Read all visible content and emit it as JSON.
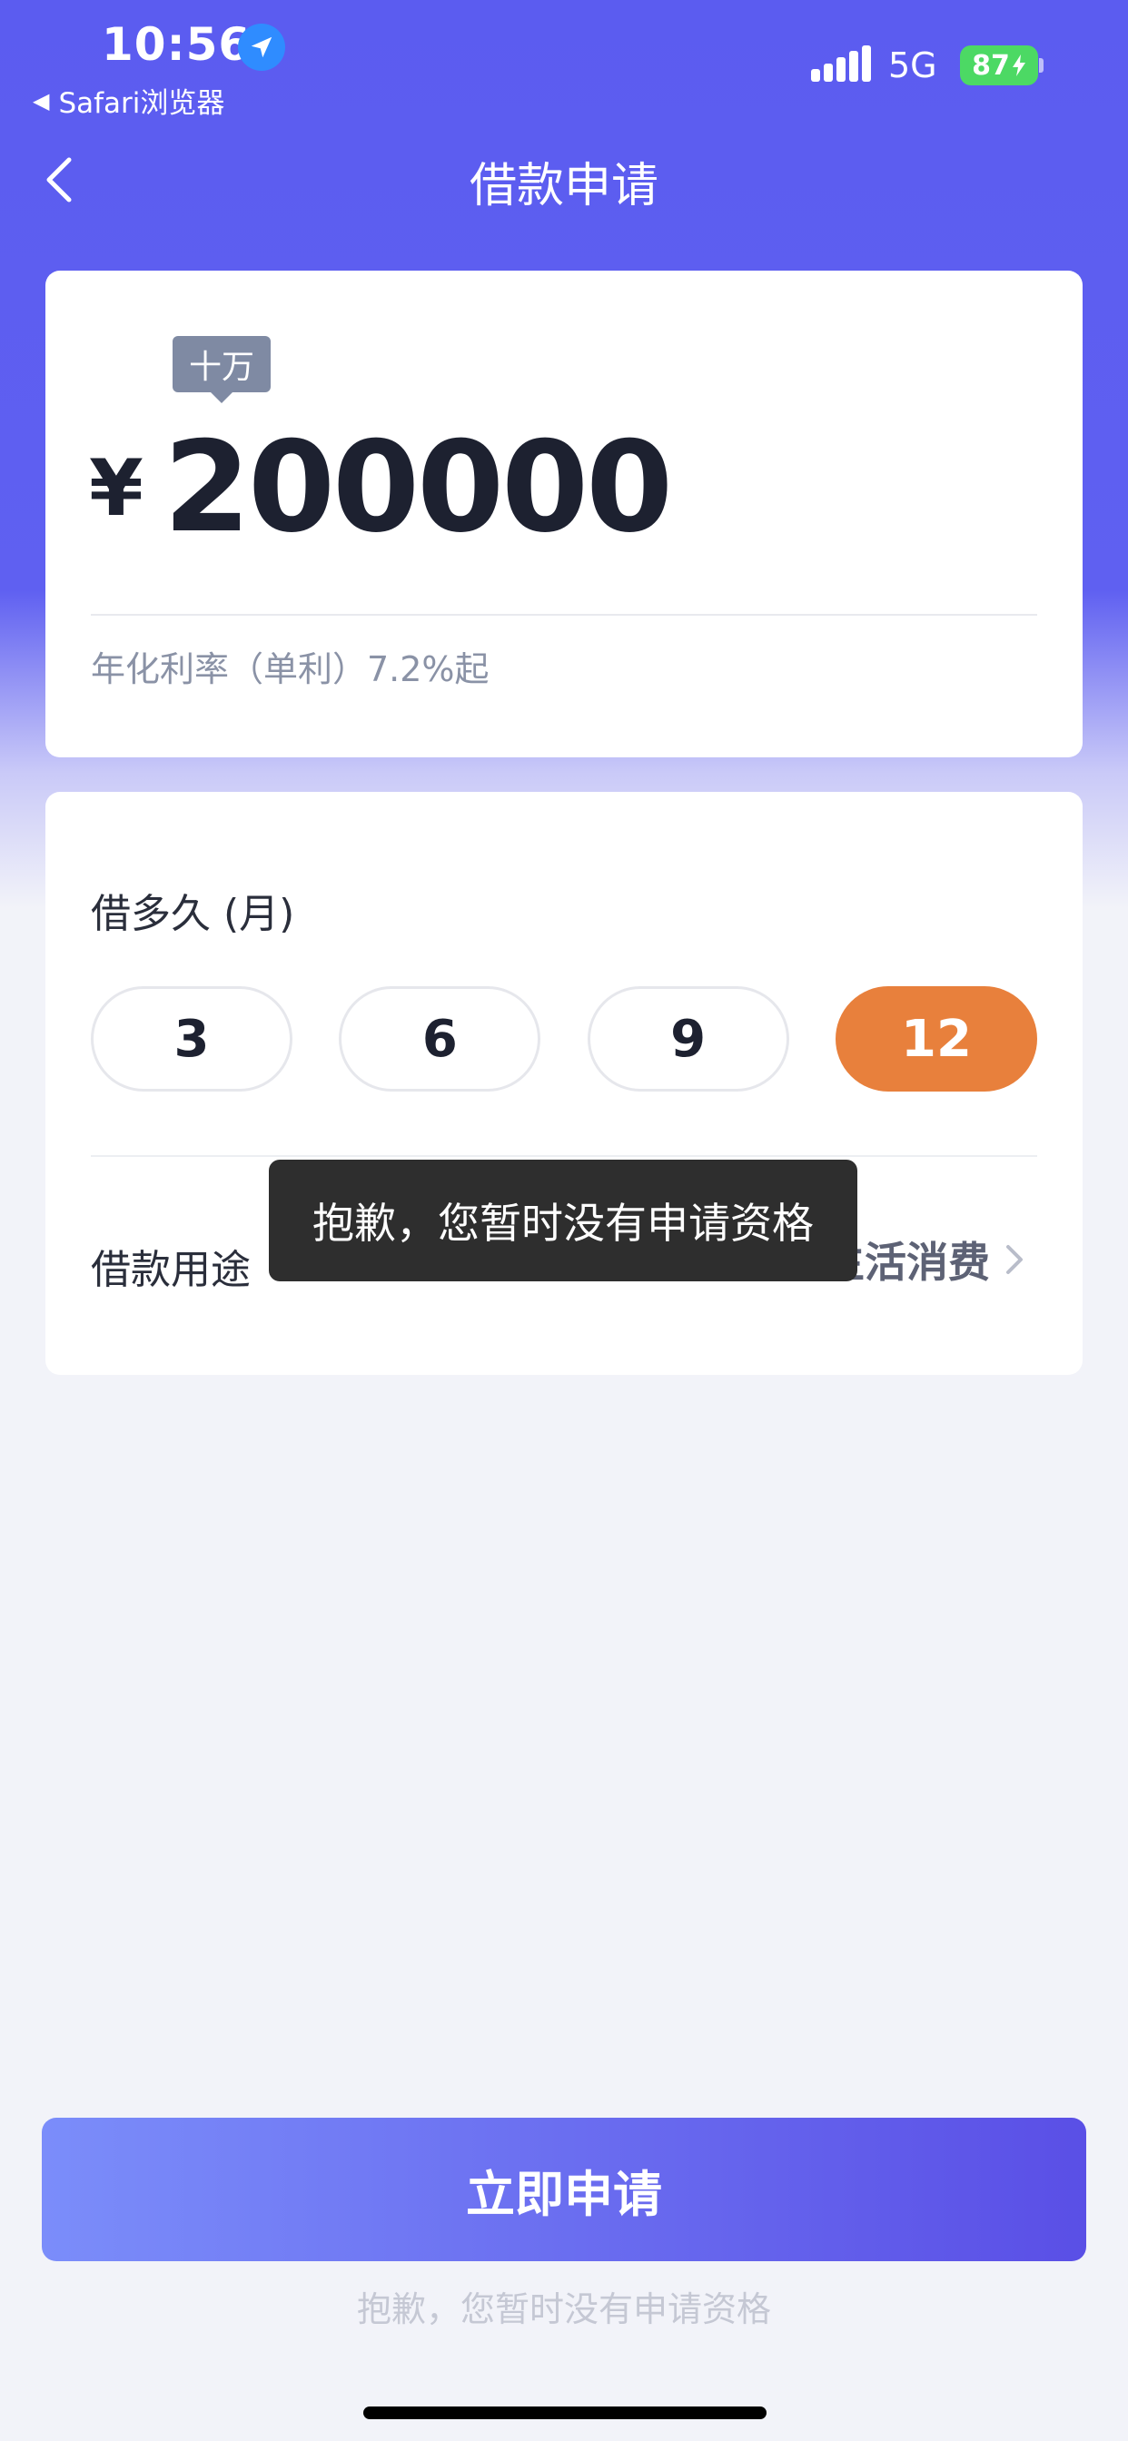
{
  "status_bar": {
    "time": "10:56",
    "back_app_label": "Safari浏览器",
    "network": "5G",
    "battery": "87"
  },
  "header": {
    "title": "借款申请"
  },
  "amount_card": {
    "unit_tooltip": "十万",
    "currency_symbol": "¥",
    "amount": "200000",
    "rate_text": "年化利率（单利）7.2%起"
  },
  "term_card": {
    "label": "借多久 (月)",
    "options": [
      "3",
      "6",
      "9",
      "12"
    ],
    "selected": "12",
    "purpose_label": "借款用途",
    "purpose_value": "生活消费"
  },
  "toast": {
    "message": "抱歉，您暂时没有申请资格"
  },
  "footer": {
    "apply_label": "立即申请",
    "ineligible_note": "抱歉，您暂时没有申请资格"
  },
  "colors": {
    "header_bg": "#5b5cf0",
    "selected_term": "#e8803c",
    "battery": "#4cd964",
    "button_gradient_start": "#7b8dfa",
    "button_gradient_end": "#5a4fe6"
  }
}
